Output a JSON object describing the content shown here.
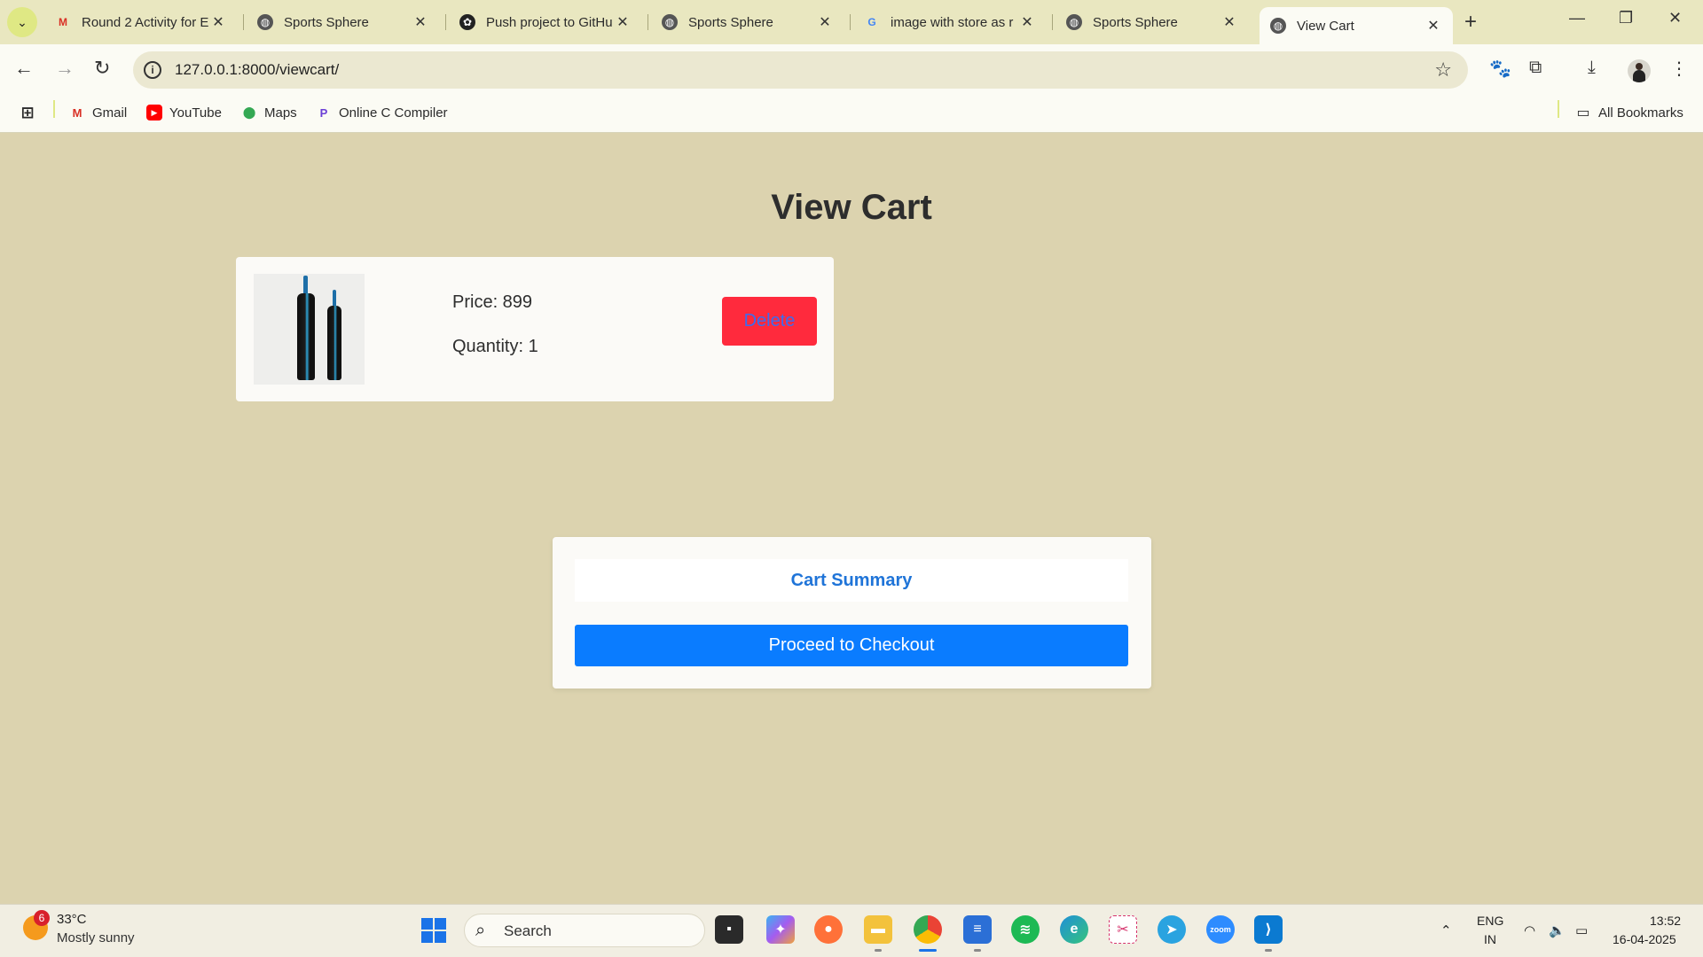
{
  "browser": {
    "tabs": [
      {
        "title": "Round 2 Activity for E",
        "favicon": "gmail-icon"
      },
      {
        "title": "Sports Sphere",
        "favicon": "globe-icon"
      },
      {
        "title": "Push project to GitHu",
        "favicon": "openai-icon"
      },
      {
        "title": "Sports Sphere",
        "favicon": "globe-icon"
      },
      {
        "title": "image with store as r",
        "favicon": "google-icon"
      },
      {
        "title": "Sports Sphere",
        "favicon": "globe-icon"
      },
      {
        "title": "View Cart",
        "favicon": "globe-icon"
      }
    ],
    "active_tab_index": 6,
    "url": "127.0.0.1:8000/viewcart/",
    "bookmarks": [
      {
        "label": "Gmail",
        "icon": "gmail-icon"
      },
      {
        "label": "YouTube",
        "icon": "youtube-icon"
      },
      {
        "label": "Maps",
        "icon": "maps-icon"
      },
      {
        "label": "Online C Compiler",
        "icon": "compiler-icon"
      }
    ],
    "all_bookmarks_label": "All Bookmarks"
  },
  "page": {
    "title": "View Cart",
    "item": {
      "image": "cricket-bat-image",
      "price_text": "Price: 899",
      "quantity_text": "Quantity: 1",
      "delete_label": "Delete"
    },
    "summary": {
      "heading": "Cart Summary",
      "checkout_label": "Proceed to Checkout"
    },
    "colors": {
      "page_bg": "#dcd3af",
      "delete_bg": "#ff2a3d",
      "checkout_bg": "#0a7cff",
      "summary_heading": "#1f74d8"
    }
  },
  "taskbar": {
    "weather": {
      "temp": "33°C",
      "desc": "Mostly sunny",
      "badge": "6"
    },
    "search_label": "Search",
    "lang_line1": "ENG",
    "lang_line2": "IN",
    "time": "13:52",
    "date": "16-04-2025"
  }
}
